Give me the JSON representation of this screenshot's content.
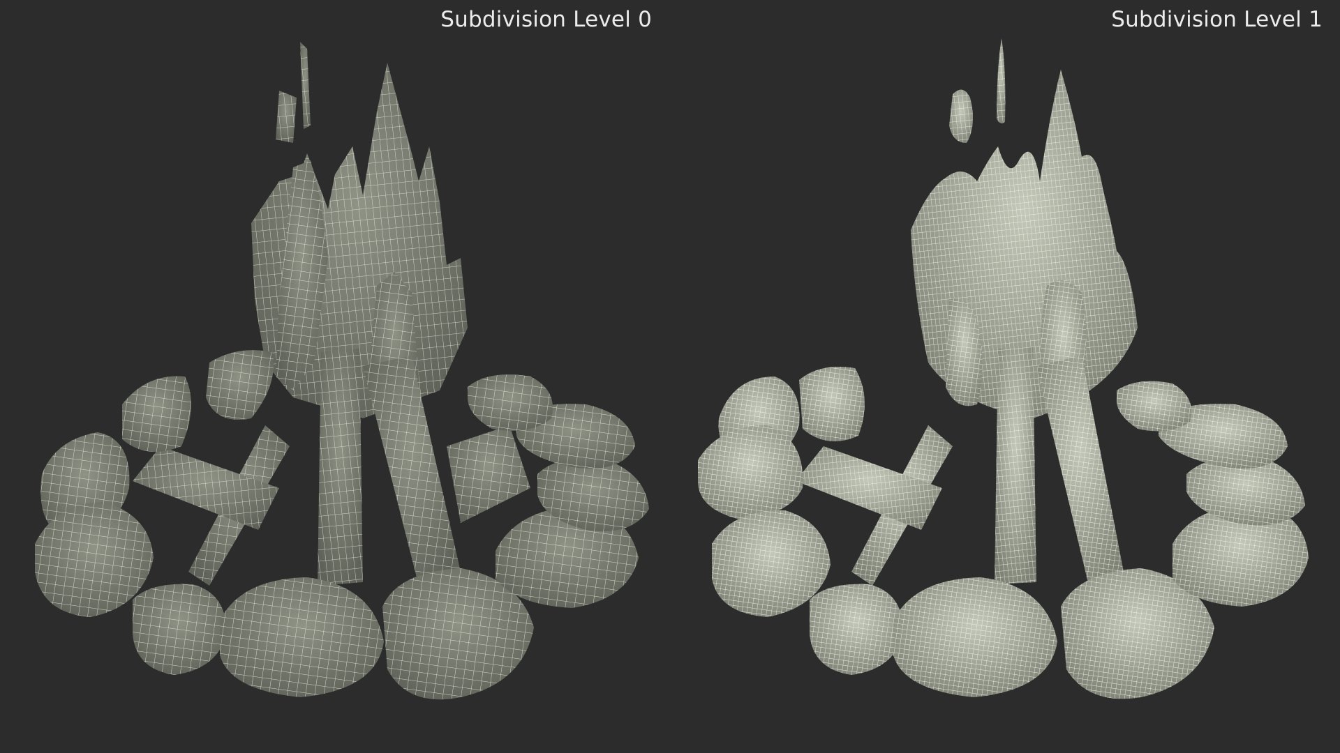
{
  "colors": {
    "background": "#2c2c2c",
    "label_text": "#ececec",
    "mesh_fill_level0": "#7e8275",
    "mesh_fill_level1": "#a7ab9c",
    "wire_level0": "#eef0e6",
    "wire_level1": "#f7f8f2"
  },
  "panels": [
    {
      "label": "Subdivision Level 0",
      "subject": "campfire-wireframe-mesh"
    },
    {
      "label": "Subdivision Level 1",
      "subject": "campfire-wireframe-mesh"
    }
  ]
}
